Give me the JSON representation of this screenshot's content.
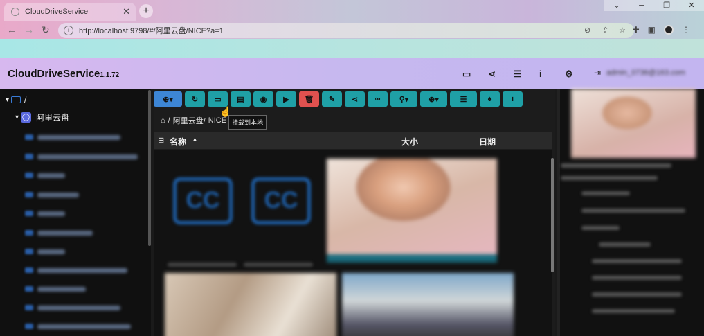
{
  "browser": {
    "tab_title": "CloudDriveService",
    "url": "http://localhost:9798/#/阿里云盘/NICE?a=1"
  },
  "app": {
    "name": "CloudDriveService",
    "version": "1.1.72"
  },
  "sidebar": {
    "root_label": "/",
    "drive_label": "阿里云盘"
  },
  "breadcrumb": {
    "home": "/",
    "drive": "阿里云盘/",
    "folder": "NICE"
  },
  "tooltip": "挂载到本地",
  "columns": {
    "name": "名称",
    "size": "大小",
    "date": "日期"
  },
  "colors": {
    "toolbar_teal": "#1fa0a6",
    "toolbar_primary": "#3d86d6",
    "toolbar_danger": "#e0514f",
    "folder_blue": "#3a7bd5"
  }
}
